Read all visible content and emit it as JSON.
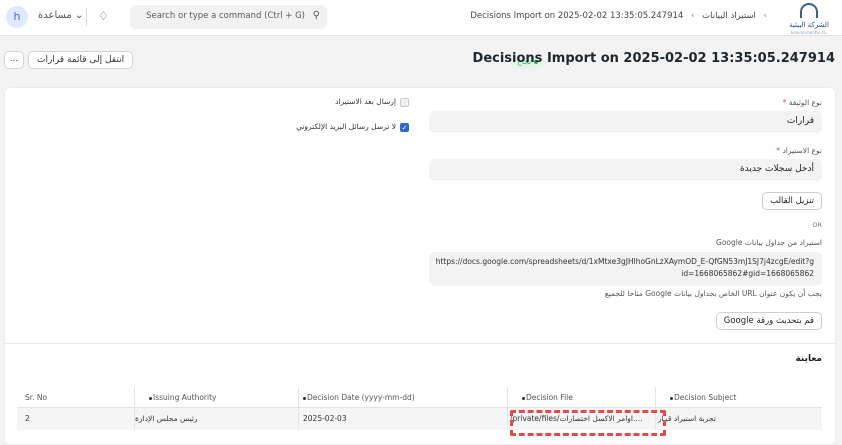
{
  "navbar": {
    "avatar_initial": "h",
    "help_label": "مساعدة ⌄",
    "notification_icon": "bell-icon",
    "search_placeholder": "Search or type a command (Ctrl + G)",
    "search_icon": "search-icon",
    "breadcrumbs": [
      "استيراد البيانات",
      "Decisions Import on 2025-02-02 13:35:05.247914"
    ],
    "logo_text": "الشركة البيئية",
    "logo_subtext": "Environmental co."
  },
  "header": {
    "title": "Decisions Import on 2025-02-02 13:35:05.247914",
    "status": "نجاح",
    "goto_list_button": "انتقل إلى قائمة قرارات",
    "more_button": "..."
  },
  "form": {
    "document_type_label": "نوع الوثيقة",
    "document_type_value": "قرارات",
    "import_type_label": "نوع الاستيراد",
    "import_type_value": "أدخل سجلات جديدة",
    "download_template_button": "تنزيل القالب",
    "or_label": "OR",
    "google_sheets_label": "استيراد من جداول بيانات Google",
    "google_sheets_url": "https://docs.google.com/spreadsheets/d/1xMtxe3gJHlhoGnLzXAymOD_E-QfGN53mJ1SJ7j4zcgE/edit?gid=1668065862#gid=1668065862",
    "google_sheets_hint": "يجب أن يكون عنوان URL الخاص بجداول بيانات Google متاحا للجميع",
    "update_sheet_button": "قم بتحديث ورقة Google",
    "send_after_import_label": "إرسال بعد الاستيراد",
    "send_after_import_checked": false,
    "no_email_label": "لا ترسل رسائل البريد الإلكتروني",
    "no_email_checked": true
  },
  "preview": {
    "title": "معاينة",
    "columns": [
      "Sr. No",
      "Issuing Authority",
      "Decision Date (yyyy-mm-dd)",
      "Decision File",
      "Decision Subject"
    ],
    "rows": [
      [
        "2",
        "رئيس مجلس الإدارة",
        "2025-02-03",
        "/private/files/اوامر الاكسل اختصارات....",
        "تجربة استيراد قرار"
      ]
    ]
  },
  "colors": {
    "status_bg": "#e4f5e9",
    "status_text": "#30a66d",
    "highlight_dash": "#e04b4b",
    "checkbox_checked": "#2c6ac9"
  }
}
